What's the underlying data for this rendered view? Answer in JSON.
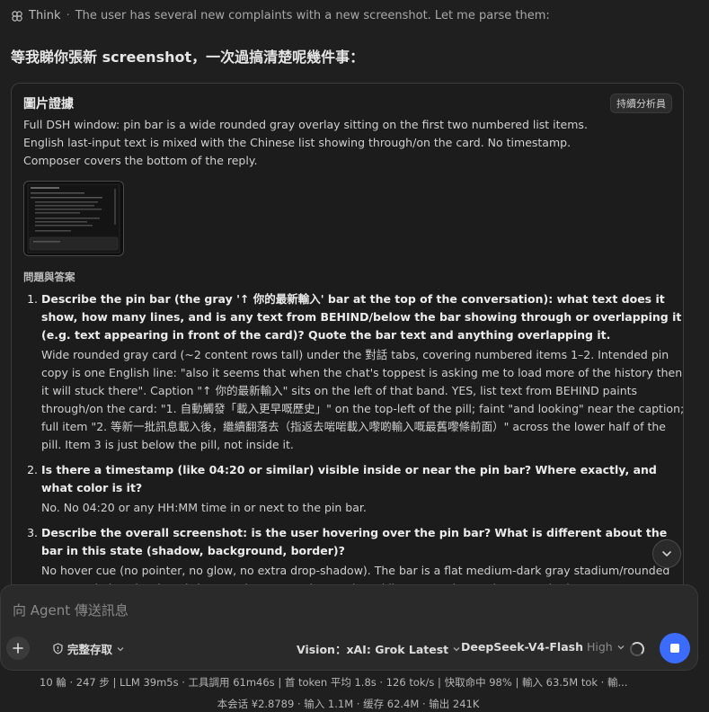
{
  "think": {
    "label": "Think",
    "separator": "·",
    "text": "The user has several new complaints with a new screenshot. Let me parse them:"
  },
  "reply_heading": "等我睇你張新 screenshot，一次過搞清楚呢幾件事：",
  "card": {
    "title": "圖片證據",
    "badge": "持續分析員",
    "description": "Full DSH window: pin bar is a wide rounded gray overlay sitting on the first two numbered list items. English last-input text is mixed with the Chinese list showing through/on the card. No timestamp. Composer covers the bottom of the reply.",
    "section_label": "問題與答案",
    "qa": [
      {
        "question": "Describe the pin bar (the gray '↑ 你的最新輸入' bar at the top of the conversation): what text does it show, how many lines, and is any text from BEHIND/below the bar showing through or overlapping it (e.g. text appearing in front of the card)? Quote the bar text and anything overlapping it.",
        "answer": "Wide rounded gray card (~2 content rows tall) under the 對話 tabs, covering numbered items 1–2. Intended pin copy is one English line: \"also it seems that when the chat's toppest is asking me to load more of the history then it will stuck there\". Caption \"↑ 你的最新輸入\" sits on the left of that band. YES, list text from BEHIND paints through/on the card: \"1. 自動觸發「載入更早嘅歷史」\" on the top-left of the pill; faint \"and looking\" near the caption; full item \"2. 等新一批訊息載入後，繼續翻落去（指返去啱啱載入嚟啲輸入嘅最舊嚟條前面）\" across the lower half of the pill. Item 3 is just below the pill, not inside it."
      },
      {
        "question": "Is there a timestamp (like 04:20 or similar) visible inside or near the pin bar? Where exactly, and what color is it?",
        "answer": "No. No 04:20 or any HH:MM time in or next to the pin bar."
      },
      {
        "question": "Describe the overall screenshot: is the user hovering over the pin bar? What is different about the bar in this state (shadow, background, border)?",
        "answer": "No hover cue (no pointer, no glow, no extra drop-shadow). The bar is a flat medium-dark gray stadium/rounded rect, no obvious border, sitting as a layer over the numbered list. Cursor is not shown on the bar."
      }
    ]
  },
  "composer": {
    "placeholder": "向 Agent 傳送訊息",
    "access_label": "完整存取",
    "vision_label": "Vision：xAI: Grok Latest",
    "model_label": "DeepSeek-V4-Flash",
    "effort_label": "High"
  },
  "stats": {
    "line1": "10 輪 · 247 步   |   LLM 39m5s · 工具調用 61m46s   |   首 token 平均 1.8s · 126 tok/s   |   快取命中 98%   |   輸入 63.5M tok · 輸...",
    "line2": "本会话 ¥2.8789 · 输入 1.1M · 缓存 62.4M · 输出 241K"
  },
  "colors": {
    "background": "#1f1f1f",
    "card_border": "#3c3c3c",
    "composer_bg": "#2a2a2a",
    "stop_button": "#3b6bff"
  },
  "icons": [
    "think-icon",
    "chevron-down-icon",
    "plus-icon",
    "shield-icon",
    "spinner-icon",
    "stop-icon"
  ]
}
